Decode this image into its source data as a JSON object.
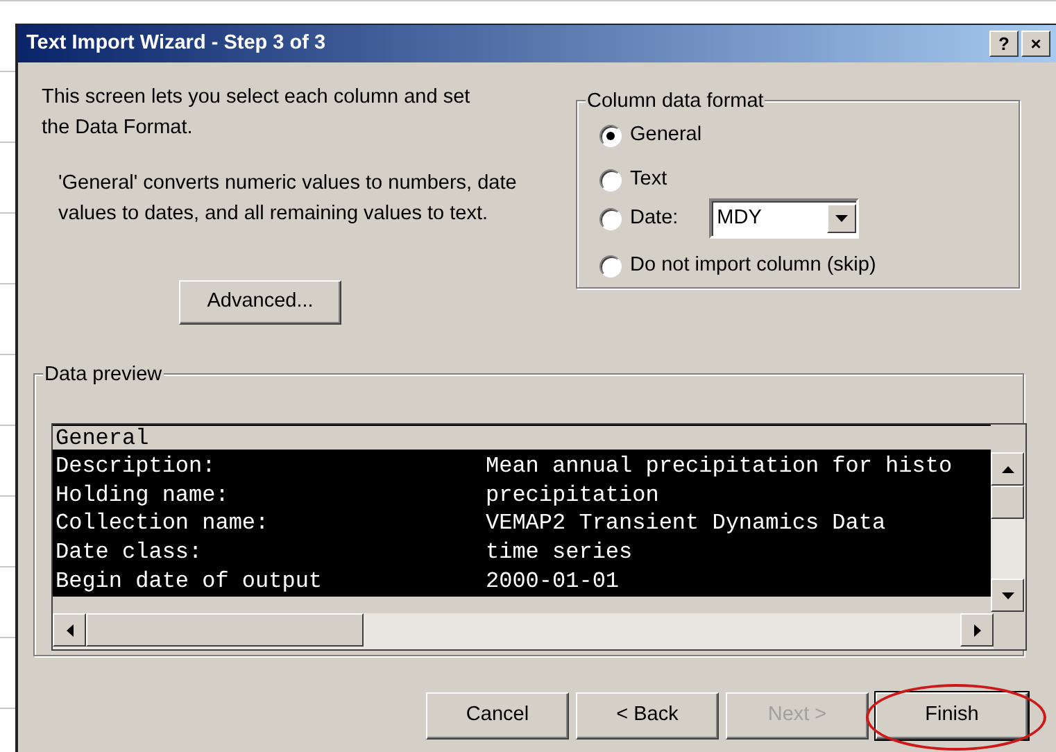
{
  "window": {
    "title": "Text Import Wizard - Step 3 of 3",
    "title_buttons": [
      "?",
      "×"
    ]
  },
  "intro": "This screen lets you select each column and set the Data Format.",
  "note": "'General' converts numeric values to numbers, date values to dates, and all remaining values to text.",
  "advanced_button": "Advanced...",
  "column_data_format": {
    "legend": "Column data format",
    "options": [
      {
        "label": "General",
        "selected": true,
        "kind": "plain"
      },
      {
        "label": "Text",
        "selected": false,
        "kind": "plain"
      },
      {
        "label": "Date:",
        "selected": false,
        "kind": "date",
        "value": "MDY"
      },
      {
        "label": "Do not import column (skip)",
        "selected": false,
        "kind": "plain"
      }
    ]
  },
  "data_preview": {
    "legend": "Data preview",
    "columns": [
      {
        "heading": "General",
        "selected": true
      }
    ],
    "rows": [
      {
        "label": "Description:",
        "value": "Mean annual precipitation for histo"
      },
      {
        "label": "Holding name:",
        "value": "precipitation"
      },
      {
        "label": "Collection name:",
        "value": "VEMAP2 Transient Dynamics Data"
      },
      {
        "label": "Date class:",
        "value": "time series"
      },
      {
        "label": "Begin date of output",
        "value": "2000-01-01"
      }
    ]
  },
  "buttons": [
    {
      "label": "Cancel",
      "disabled": false,
      "highlighted": false
    },
    {
      "label": "< Back",
      "disabled": false,
      "highlighted": false
    },
    {
      "label": "Next >",
      "disabled": true,
      "highlighted": false
    },
    {
      "label": "Finish",
      "disabled": false,
      "highlighted": true
    }
  ]
}
